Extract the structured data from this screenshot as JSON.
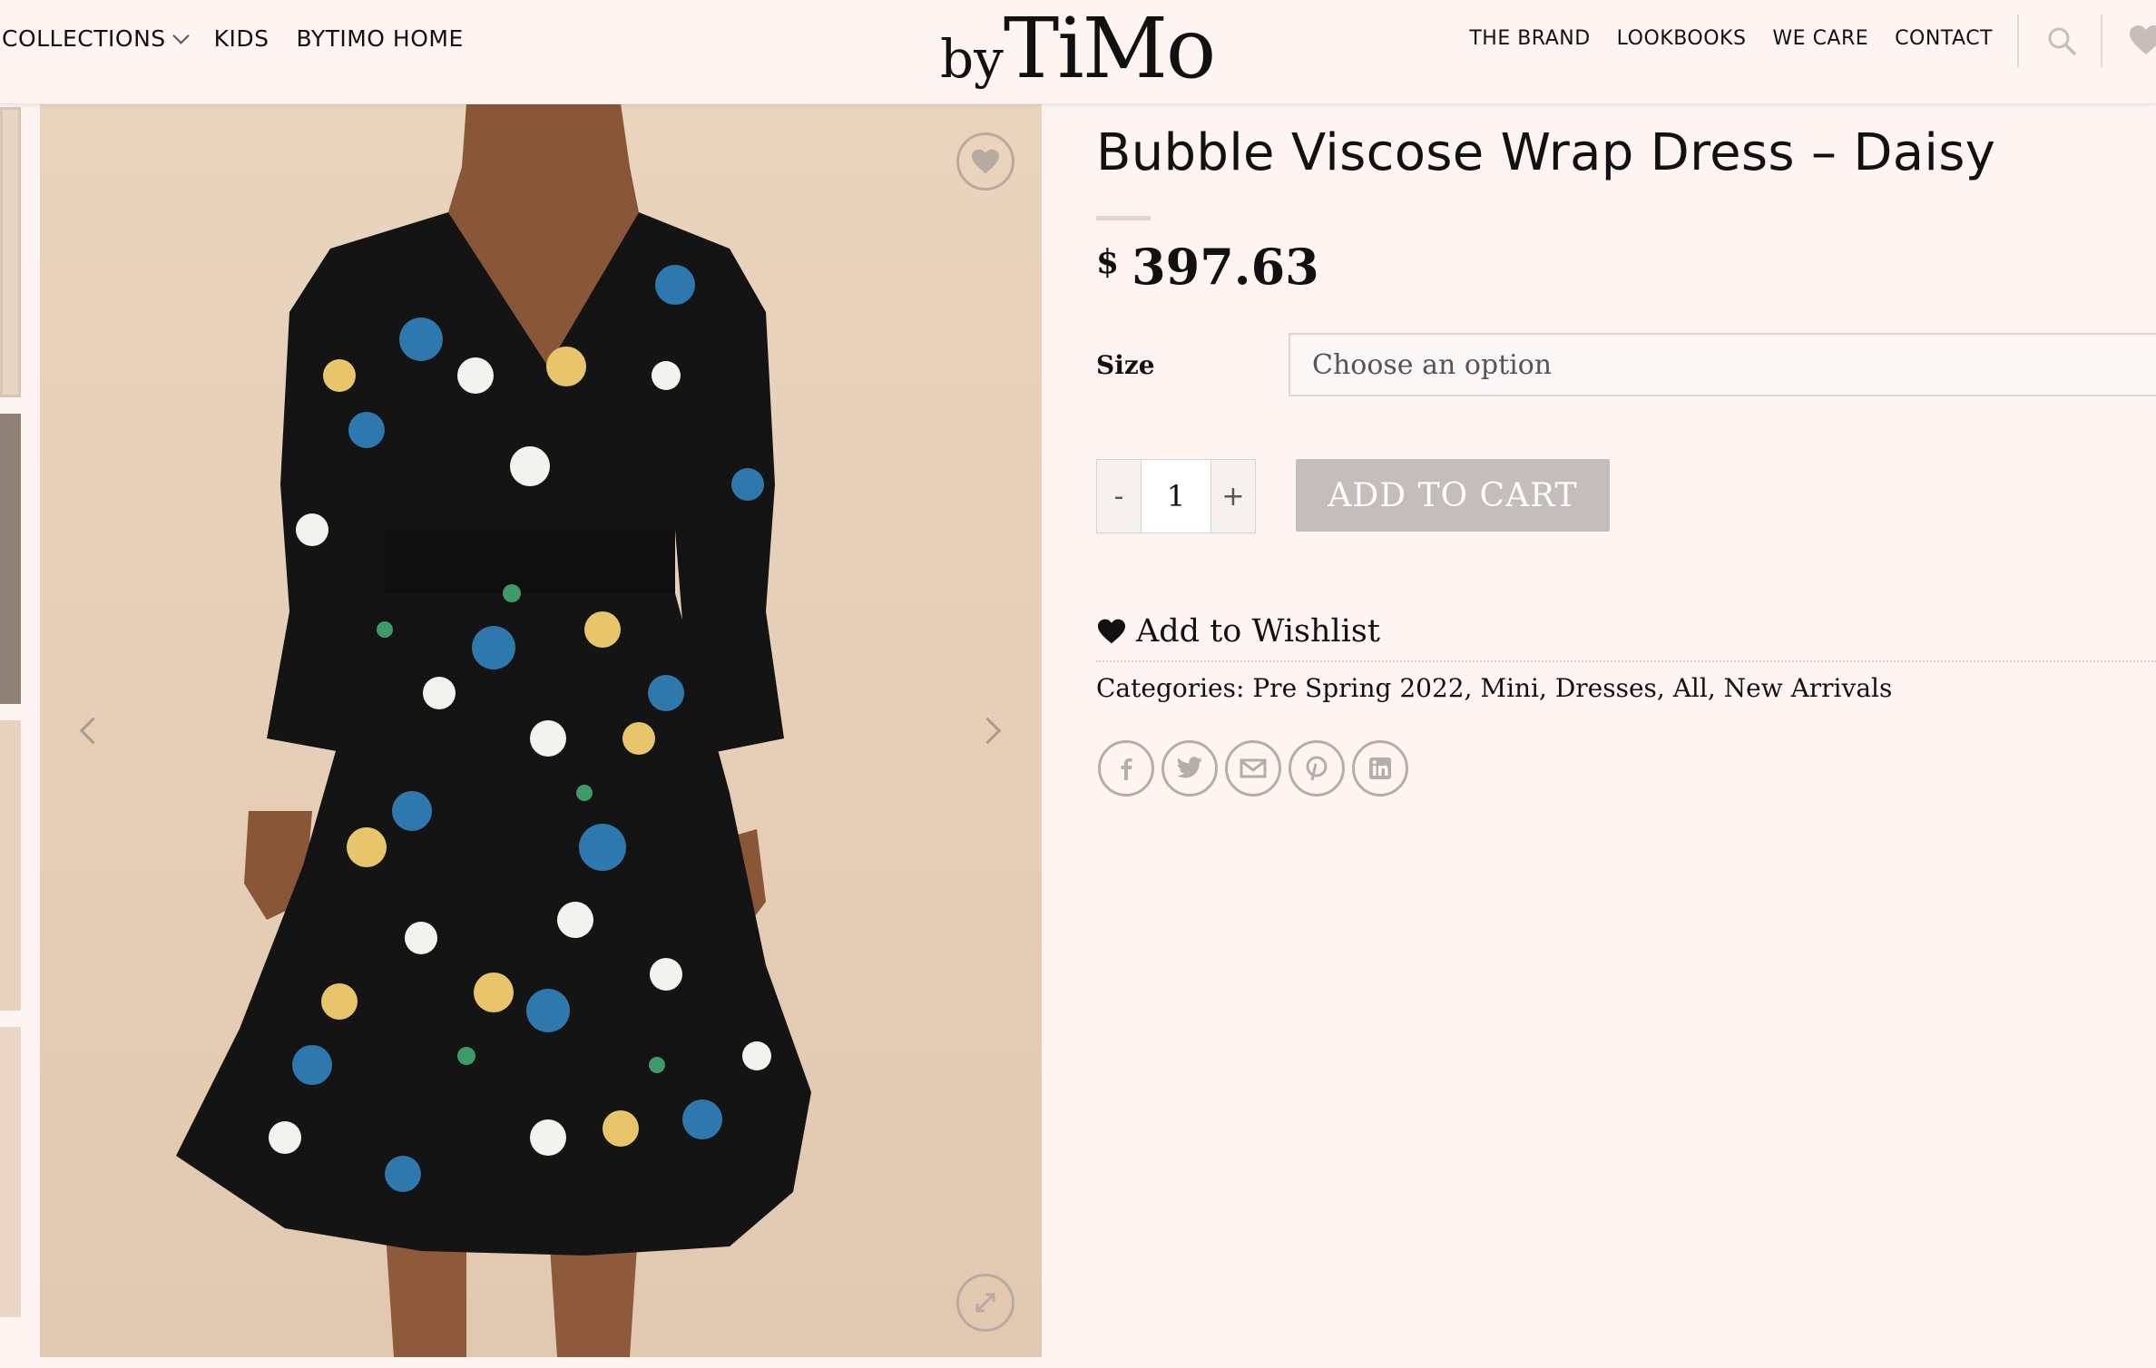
{
  "header": {
    "logo_by": "by",
    "logo_timo": "TiMo",
    "nav_left": [
      "COLLECTIONS",
      "KIDS",
      "BYTIMO HOME"
    ],
    "nav_right": [
      "THE BRAND",
      "LOOKBOOKS",
      "WE CARE",
      "CONTACT"
    ]
  },
  "product": {
    "title": "Bubble Viscose Wrap Dress – Daisy",
    "price_currency": "$",
    "price_amount": "397.63",
    "size_label": "Size",
    "size_placeholder": "Choose an option",
    "qty_minus": "-",
    "qty_value": "1",
    "qty_plus": "+",
    "add_to_cart": "ADD TO CART",
    "wishlist": "Add to Wishlist",
    "categories_label": "Categories:",
    "categories": "Pre Spring 2022, Mini, Dresses, All, New Arrivals"
  },
  "share_icons": [
    "facebook-icon",
    "twitter-icon",
    "email-icon",
    "pinterest-icon",
    "linkedin-icon"
  ],
  "colors": {
    "page_bg": "#fef5f3",
    "button_bg": "#c4bdbb",
    "dress_black": "#141414",
    "flower_blue": "#2f78ad",
    "flower_yellow": "#e8c46a"
  }
}
